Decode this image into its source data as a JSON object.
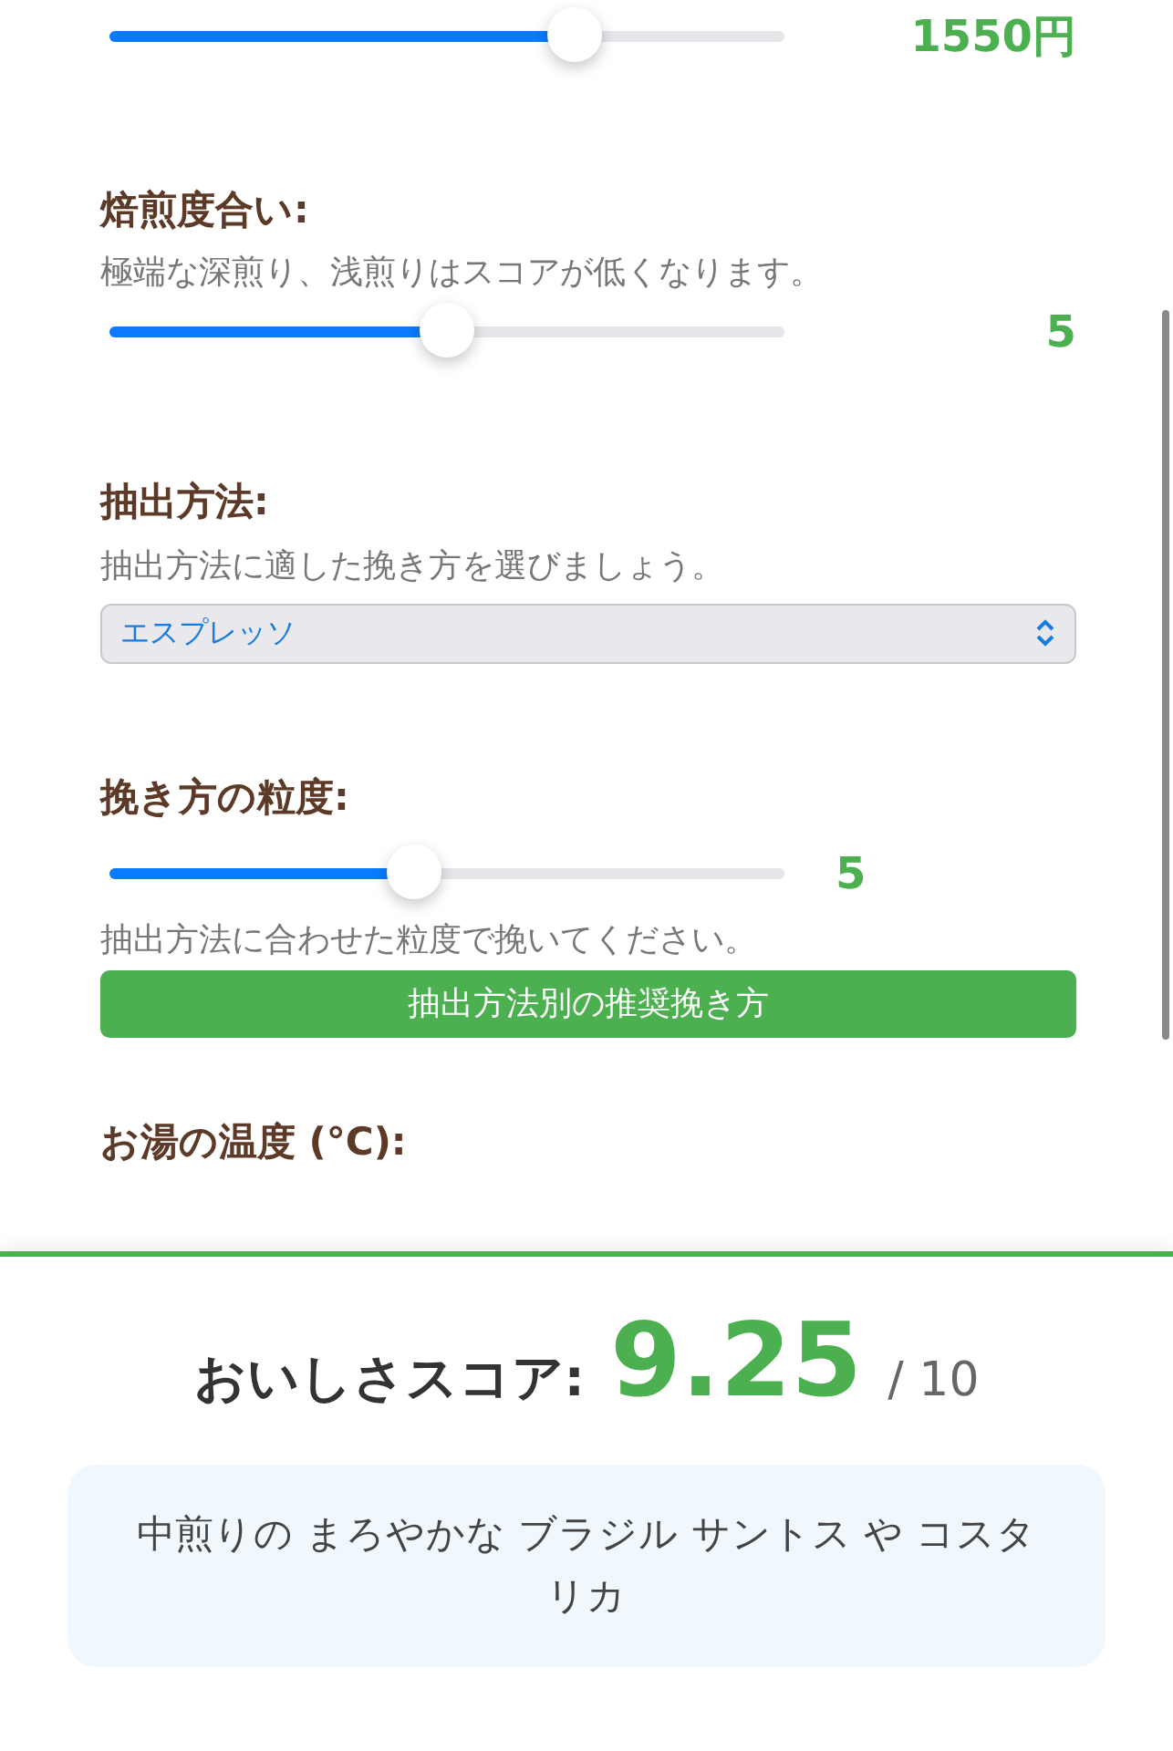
{
  "settings": [
    {
      "kind": "slider",
      "level": 0.69,
      "reading": "1550円"
    },
    {
      "kind": "slider",
      "label": "焙煎度合い:",
      "description": "極端な深煎り、浅煎りはスコアが低くなります。",
      "level": 0.5,
      "reading": "5"
    },
    {
      "kind": "select",
      "label": "抽出方法:",
      "description": "抽出方法に適した挽き方を選びましょう。",
      "value": "エスプレッソ"
    },
    {
      "kind": "slider-inline",
      "label": "挽き方の粒度:",
      "level": 0.45,
      "reading": "5",
      "description": "抽出方法に合わせた粒度で挽いてください。",
      "button": "抽出方法別の推奨挽き方"
    },
    {
      "kind": "heading",
      "label": "お湯の温度 (°C):"
    }
  ],
  "score_panel": {
    "label": "おいしさスコア:",
    "score": "9.25",
    "max": "/ 10",
    "recommendation": "中煎りの まろやかな ブラジル サントス や コスタリカ"
  }
}
